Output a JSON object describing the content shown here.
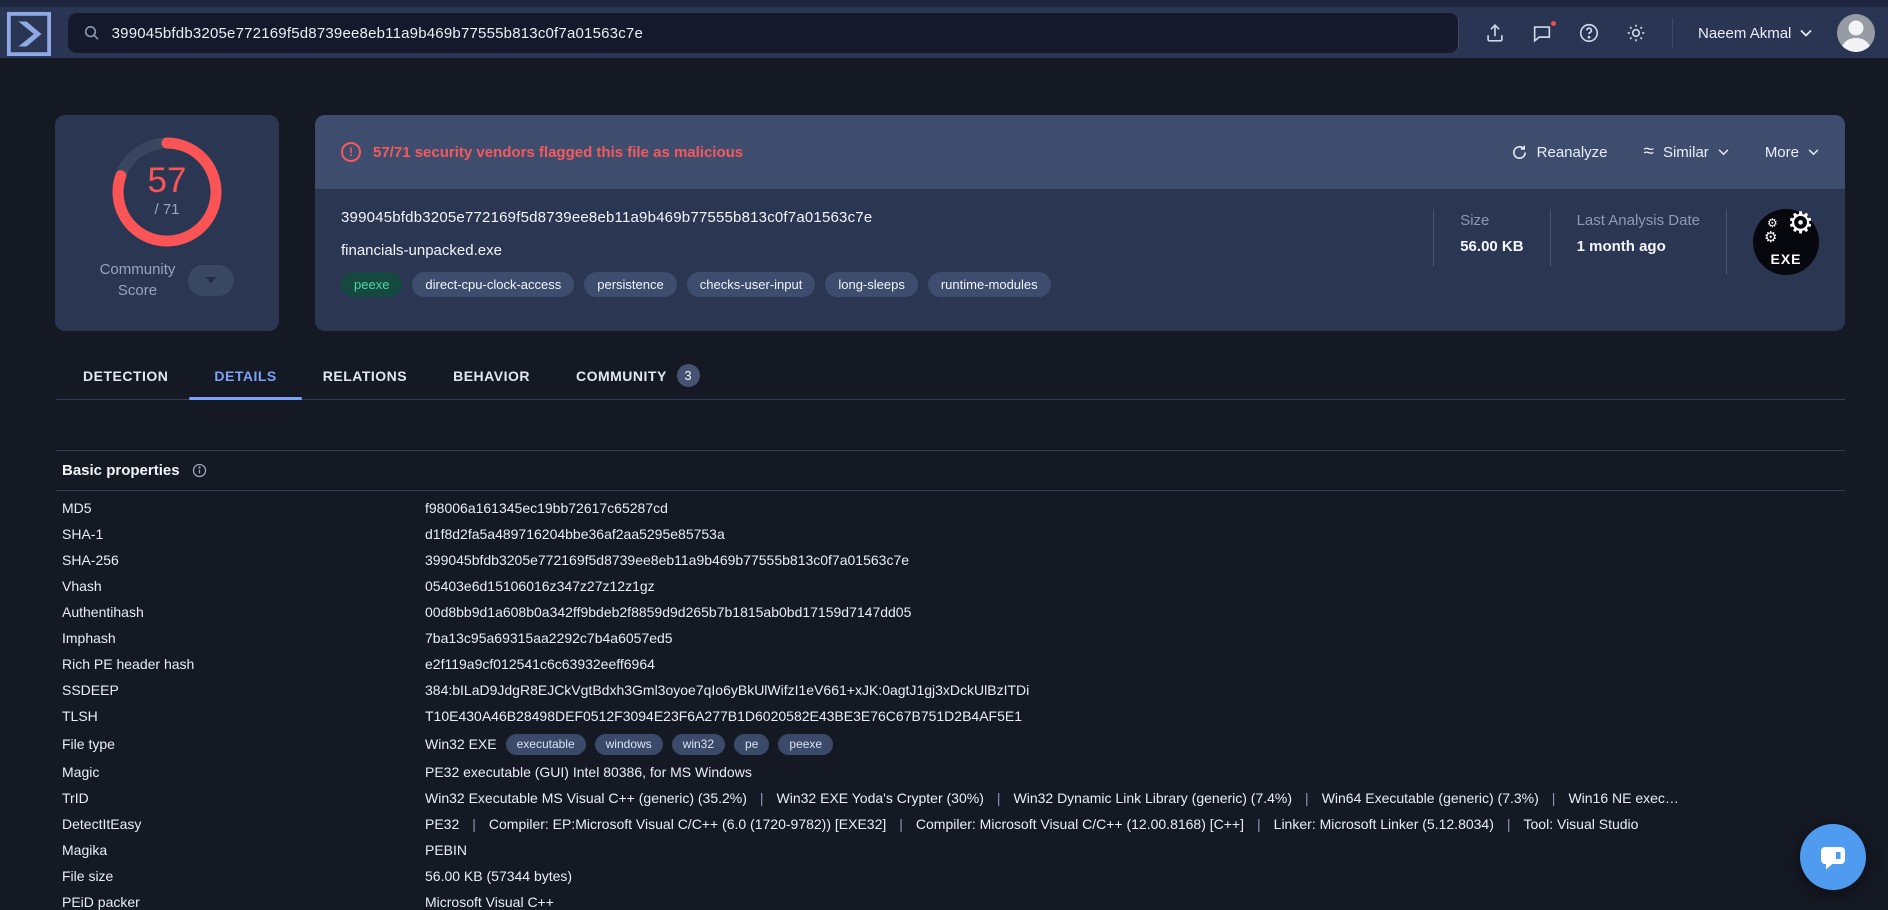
{
  "topbar": {
    "search_value": "399045bfdb3205e772169f5d8739ee8eb11a9b469b77555b813c0f7a01563c7e",
    "user_name": "Naeem Akmal"
  },
  "score_card": {
    "malicious": 57,
    "total": 71,
    "score_display": "57",
    "total_display": "/ 71",
    "label_line1": "Community",
    "label_line2": "Score"
  },
  "banner": {
    "warning_text": "57/71 security vendors flagged this file as malicious",
    "actions": {
      "reanalyze": "Reanalyze",
      "similar": "Similar",
      "more": "More"
    }
  },
  "file": {
    "sha256": "399045bfdb3205e772169f5d8739ee8eb11a9b469b77555b813c0f7a01563c7e",
    "name": "financials-unpacked.exe",
    "tags": [
      {
        "label": "peexe",
        "style": "green"
      },
      {
        "label": "direct-cpu-clock-access"
      },
      {
        "label": "persistence"
      },
      {
        "label": "checks-user-input"
      },
      {
        "label": "long-sleeps"
      },
      {
        "label": "runtime-modules"
      }
    ],
    "size": {
      "label": "Size",
      "value": "56.00 KB"
    },
    "last_analysis": {
      "label": "Last Analysis Date",
      "value": "1 month ago"
    },
    "file_type_badge": "EXE"
  },
  "tabs": [
    {
      "label": "DETECTION"
    },
    {
      "label": "DETAILS",
      "active": true
    },
    {
      "label": "RELATIONS"
    },
    {
      "label": "BEHAVIOR"
    },
    {
      "label": "COMMUNITY",
      "badge": "3"
    }
  ],
  "details": {
    "section_title": "Basic properties",
    "rows": [
      {
        "label": "MD5",
        "value": "f98006a161345ec19bb72617c65287cd"
      },
      {
        "label": "SHA-1",
        "value": "d1f8d2fa5a489716204bbe36af2aa5295e85753a"
      },
      {
        "label": "SHA-256",
        "value": "399045bfdb3205e772169f5d8739ee8eb11a9b469b77555b813c0f7a01563c7e"
      },
      {
        "label": "Vhash",
        "value": "05403e6d15106016z347z27z12z1gz"
      },
      {
        "label": "Authentihash",
        "value": "00d8bb9d1a608b0a342ff9bdeb2f8859d9d265b7b1815ab0bd17159d7147dd05"
      },
      {
        "label": "Imphash",
        "value": "7ba13c95a69315aa2292c7b4a6057ed5"
      },
      {
        "label": "Rich PE header hash",
        "value": "e2f119a9cf012541c6c63932eeff6964"
      },
      {
        "label": "SSDEEP",
        "value": "384:bILaD9JdgR8EJCkVgtBdxh3Gml3oyoe7qIo6yBkUlWifzI1eV661+xJK:0agtJ1gj3xDckUlBzITDi"
      },
      {
        "label": "TLSH",
        "value": "T10E430A46B28498DEF0512F3094E23F6A277B1D6020582E43BE3E76C67B751D2B4AF5E1"
      },
      {
        "label": "File type",
        "type": "filetype",
        "value": "Win32 EXE",
        "pills": [
          "executable",
          "windows",
          "win32",
          "pe",
          "peexe"
        ]
      },
      {
        "label": "Magic",
        "value": "PE32 executable (GUI) Intel 80386, for MS Windows"
      },
      {
        "label": "TrID",
        "type": "segments",
        "value": [
          "Win32 Executable MS Visual C++ (generic) (35.2%)",
          "Win32 EXE Yoda's Crypter (30%)",
          "Win32 Dynamic Link Library (generic) (7.4%)",
          "Win64 Executable (generic) (7.3%)",
          "Win16 NE exec…"
        ]
      },
      {
        "label": "DetectItEasy",
        "type": "segments",
        "value": [
          "PE32",
          "Compiler: EP:Microsoft Visual C/C++ (6.0 (1720-9782)) [EXE32]",
          "Compiler: Microsoft Visual C/C++ (12.00.8168) [C++]",
          "Linker: Microsoft Linker (5.12.8034)",
          "Tool: Visual Studio"
        ]
      },
      {
        "label": "Magika",
        "value": "PEBIN"
      },
      {
        "label": "File size",
        "value": "56.00 KB (57344 bytes)"
      },
      {
        "label": "PEiD packer",
        "value": "Microsoft Visual C++"
      }
    ]
  },
  "colors": {
    "page": "#151923",
    "topbar": "#2a3453",
    "card": "#2b3752",
    "banner": "#3e4d6e",
    "red": "#fb5457",
    "accent-blue": "#7ba2f8",
    "fab": "#4f9bf0",
    "green-tag-bg": "#15493f",
    "green-tag-text": "#4fd6a6"
  }
}
